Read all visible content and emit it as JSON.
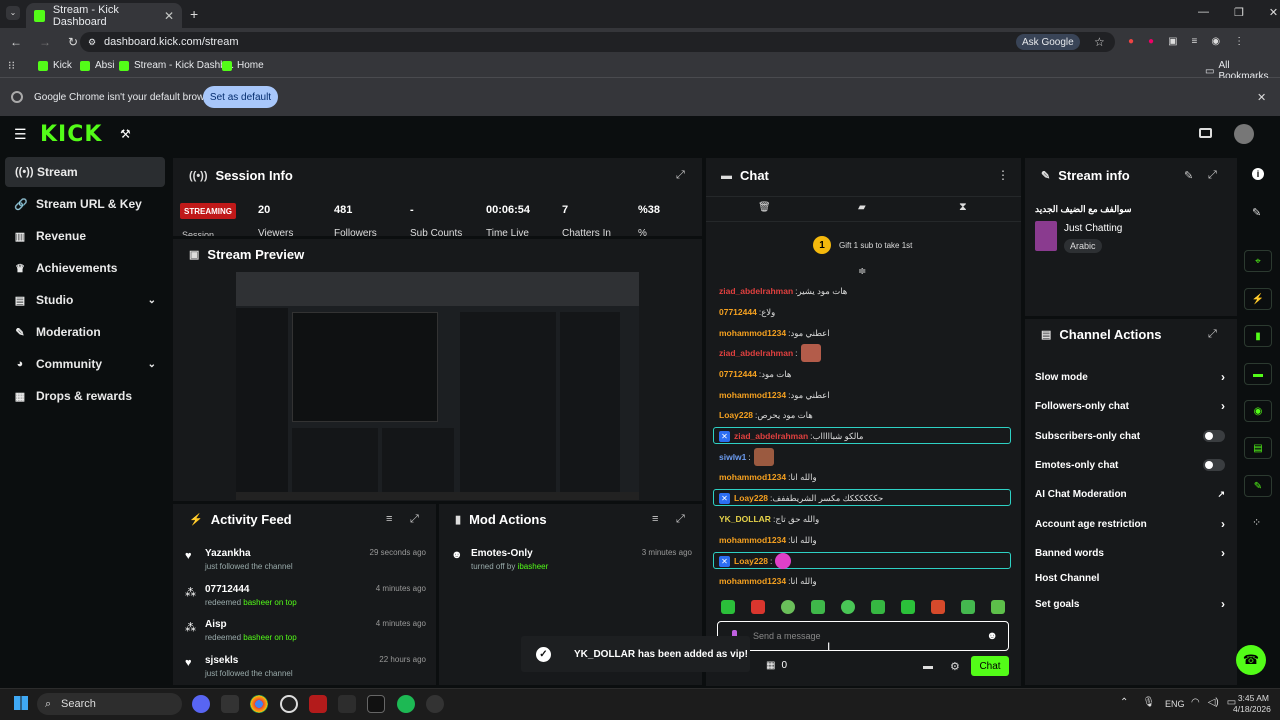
{
  "browser": {
    "tab_title": "Stream - Kick Dashboard",
    "url": "dashboard.kick.com/stream",
    "ask_google": "Ask Google",
    "bookmarks": [
      "Kick",
      "Absi",
      "Stream - Kick Dashb...",
      "Home"
    ],
    "all_bookmarks": "All Bookmarks",
    "infobar_text": "Google Chrome isn't your default browser",
    "set_default": "Set as default"
  },
  "header": {
    "logo": "KICK"
  },
  "sidebar": {
    "items": [
      {
        "label": "Stream",
        "icon": "antenna-icon"
      },
      {
        "label": "Stream URL & Key",
        "icon": "link-icon"
      },
      {
        "label": "Revenue",
        "icon": "chart-icon"
      },
      {
        "label": "Achievements",
        "icon": "trophy-icon"
      },
      {
        "label": "Studio",
        "icon": "studio-icon"
      },
      {
        "label": "Moderation",
        "icon": "wrench-icon"
      },
      {
        "label": "Community",
        "icon": "people-icon"
      },
      {
        "label": "Drops & rewards",
        "icon": "gift-icon"
      }
    ]
  },
  "session": {
    "title": "Session Info",
    "badge": "STREAMING",
    "badge_label": "Session",
    "stats": [
      {
        "value": "20",
        "label": "Viewers"
      },
      {
        "value": "481",
        "label": "Followers"
      },
      {
        "value": "-",
        "label": "Sub Counts"
      },
      {
        "value": "00:06:54",
        "label": "Time Live"
      },
      {
        "value": "7",
        "label": "Chatters In"
      },
      {
        "value": "%38",
        "label": "%"
      }
    ]
  },
  "preview": {
    "title": "Stream Preview"
  },
  "activity": {
    "title": "Activity Feed",
    "items": [
      {
        "name": "Yazankha",
        "sub": "just followed the channel",
        "reward": "",
        "time": "29 seconds ago",
        "icon": "heart-icon"
      },
      {
        "name": "07712444",
        "sub": "redeemed",
        "reward": "basheer on top",
        "time": "4 minutes ago",
        "icon": "redeem-icon"
      },
      {
        "name": "Aisp",
        "sub": "redeemed",
        "reward": "basheer on top",
        "time": "4 minutes ago",
        "icon": "redeem-icon"
      },
      {
        "name": "sjsekls",
        "sub": "just followed the channel",
        "reward": "",
        "time": "22 hours ago",
        "icon": "heart-icon"
      }
    ]
  },
  "mod_actions": {
    "title": "Mod Actions",
    "items": [
      {
        "name": "Emotes-Only",
        "sub": "turned off by",
        "by": "ibasheer",
        "time": "3 minutes ago"
      }
    ]
  },
  "chat": {
    "title": "Chat",
    "pinned": "Gift 1 sub to take 1st",
    "pinned_count": "1",
    "messages": [
      {
        "user": "ziad_abdelrahman",
        "text": "هات مود يشير",
        "color": "#e0403f"
      },
      {
        "user": "07712444",
        "text": "ولاع",
        "color": "#f4a020"
      },
      {
        "user": "mohammod1234",
        "text": "اعطني مود",
        "color": "#f4a020"
      },
      {
        "user": "ziad_abdelrahman",
        "text": "",
        "color": "#e0403f"
      },
      {
        "user": "07712444",
        "text": "هات مود",
        "color": "#f4a020"
      },
      {
        "user": "mohammod1234",
        "text": "اعطني مود",
        "color": "#f4a020"
      },
      {
        "user": "Loay228",
        "text": "هات مود يحرص",
        "color": "#f4a020"
      },
      {
        "user": "ziad_abdelrahman",
        "text": "مالكو شباااااب",
        "color": "#e0403f"
      },
      {
        "user": "siwlw1",
        "text": "",
        "color": "#6c9cf0"
      },
      {
        "user": "mohammod1234",
        "text": "والله انا",
        "color": "#f4a020"
      },
      {
        "user": "Loay228",
        "text": "حككككككك مكسر الشريطففف",
        "color": "#f4a020"
      },
      {
        "user": "YK_DOLLAR",
        "text": "والله حق تاج",
        "color": "#e5d24a"
      },
      {
        "user": "mohammod1234",
        "text": "والله انا",
        "color": "#f4a020"
      },
      {
        "user": "Loay228",
        "text": "",
        "color": "#f4a020"
      },
      {
        "user": "mohammod1234",
        "text": "والله انا",
        "color": "#f4a020"
      }
    ],
    "placeholder": "Send a message",
    "points": "0",
    "send": "Chat"
  },
  "stream_info": {
    "title": "Stream info",
    "stream_title": "سوالفف مع الضيف الجديد",
    "category": "Just Chatting",
    "language": "Arabic"
  },
  "channel_actions": {
    "title": "Channel Actions",
    "items": [
      {
        "label": "Slow mode",
        "control": "arrow"
      },
      {
        "label": "Followers-only chat",
        "control": "arrow"
      },
      {
        "label": "Subscribers-only chat",
        "control": "toggle"
      },
      {
        "label": "Emotes-only chat",
        "control": "toggle"
      },
      {
        "label": "AI Chat Moderation",
        "control": "external"
      },
      {
        "label": "Account age restriction",
        "control": "arrow"
      },
      {
        "label": "Banned words",
        "control": "arrow"
      },
      {
        "label": "Host Channel",
        "control": "none"
      },
      {
        "label": "Set goals",
        "control": "arrow"
      }
    ]
  },
  "toast": {
    "text": "YK_DOLLAR has been added as vip!"
  },
  "taskbar": {
    "search": "Search",
    "lang": "ENG",
    "time": "3:45 AM",
    "date": "4/18/2026"
  },
  "colors": {
    "accent": "#53fc18",
    "live": "#c01919"
  }
}
